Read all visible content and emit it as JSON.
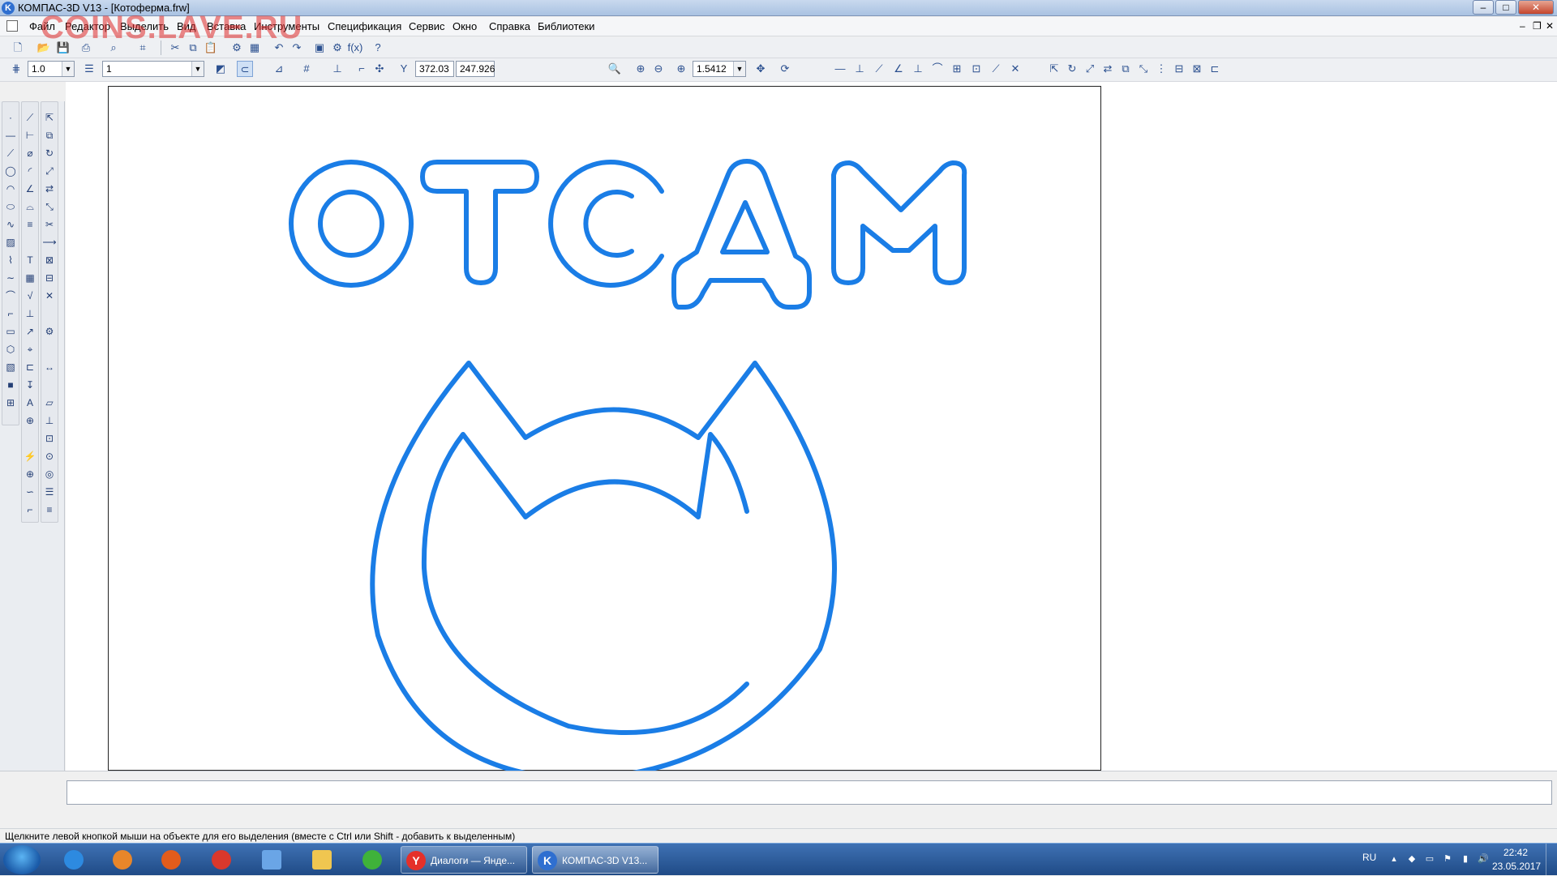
{
  "window": {
    "title": "КОМПАС-3D V13 - [Котоферма.frw]",
    "app_icon": "kompas-logo-icon"
  },
  "watermark": "COINS.LAVE.RU",
  "menu": {
    "items": [
      "Файл",
      "Редактор",
      "Выделить",
      "Вид",
      "Вставка",
      "Инструменты",
      "Спецификация",
      "Сервис",
      "Окно",
      "Справка",
      "Библиотеки"
    ]
  },
  "toolbar2": {
    "step": "1.0",
    "layer": "1",
    "coord_x": "372.03",
    "coord_y": "247.926",
    "zoom": "1.5412"
  },
  "drawing": {
    "text": "ОТСДМ",
    "line_color": "#1a7de6"
  },
  "status": {
    "hint": "Щелкните левой кнопкой мыши на объекте для его выделения (вместе с Ctrl или Shift - добавить к выделенным)"
  },
  "taskbar": {
    "tasks": [
      {
        "label": "Диалоги — Янде...",
        "icon": "yandex-browser-icon"
      },
      {
        "label": "КОМПАС-3D V13...",
        "icon": "kompas-icon"
      }
    ],
    "lang": "RU",
    "time": "22:42",
    "date": "23.05.2017"
  },
  "colors": {
    "accent": "#1a7de6",
    "taskbar": "#2b5b9a"
  }
}
